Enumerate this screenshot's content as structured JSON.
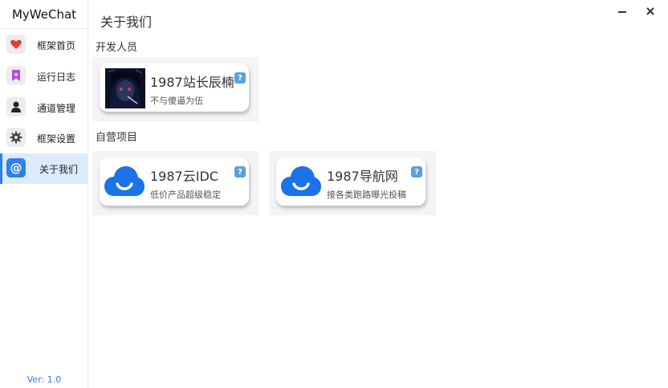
{
  "app": {
    "title": "MyWeChat",
    "version": "Ver: 1.0"
  },
  "window": {
    "minimize_icon": "minimize-icon",
    "close_icon": "close-icon"
  },
  "sidebar": {
    "items": [
      {
        "label": "框架首页",
        "icon": "heart-icon",
        "active": false
      },
      {
        "label": "运行日志",
        "icon": "bookmark-icon",
        "active": false
      },
      {
        "label": "通道管理",
        "icon": "user-icon",
        "active": false
      },
      {
        "label": "框架设置",
        "icon": "gear-icon",
        "active": false
      },
      {
        "label": "关于我们",
        "icon": "at-icon",
        "active": true
      }
    ]
  },
  "page": {
    "title": "关于我们"
  },
  "sections": {
    "developers": {
      "title": "开发人员",
      "cards": [
        {
          "name": "1987站长辰楠",
          "desc": "不与傻逼为伍",
          "help": "?"
        }
      ]
    },
    "projects": {
      "title": "自营项目",
      "cards": [
        {
          "name": "1987云IDC",
          "desc": "低价产品超级稳定",
          "help": "?"
        },
        {
          "name": "1987导航网",
          "desc": "接各类跑路曝光投稿",
          "help": "?"
        }
      ]
    }
  },
  "colors": {
    "accent": "#2f7ef0",
    "active_bg": "#dcebfb",
    "cloud": "#1a73e8",
    "heart": "#e53935",
    "bookmark": "#b44bd8"
  }
}
